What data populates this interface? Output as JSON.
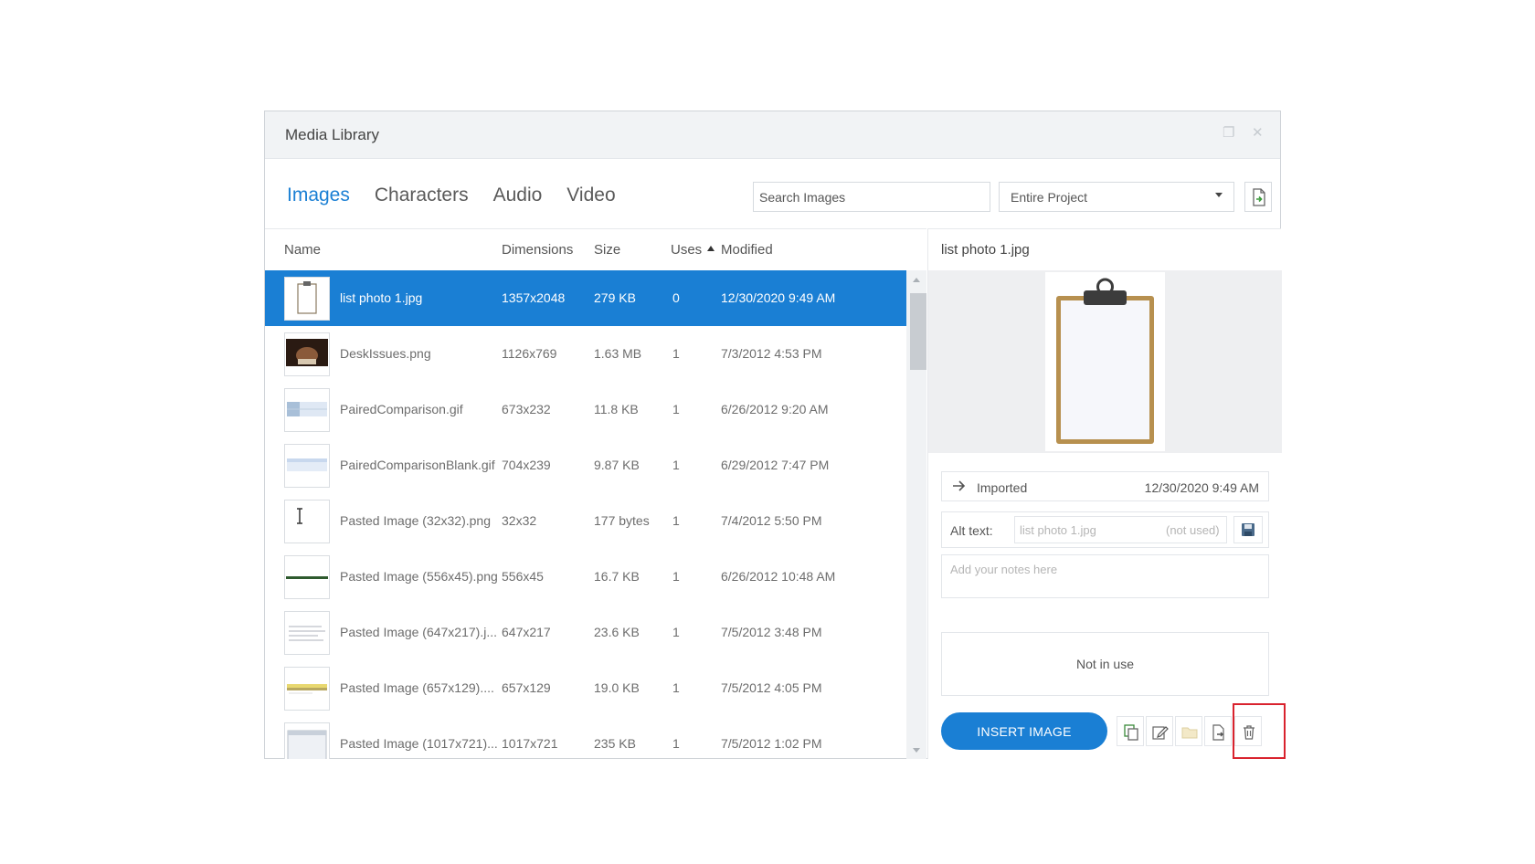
{
  "window": {
    "title": "Media Library"
  },
  "tabs": [
    {
      "label": "Images",
      "active": true
    },
    {
      "label": "Characters",
      "active": false
    },
    {
      "label": "Audio",
      "active": false
    },
    {
      "label": "Video",
      "active": false
    }
  ],
  "search": {
    "placeholder": "Search Images"
  },
  "scope": {
    "selected": "Entire Project"
  },
  "columns": {
    "name": "Name",
    "dimensions": "Dimensions",
    "size": "Size",
    "uses": "Uses",
    "modified": "Modified"
  },
  "files": [
    {
      "name": "list photo 1.jpg",
      "dimensions": "1357x2048",
      "size": "279 KB",
      "uses": "0",
      "modified": "12/30/2020 9:49 AM",
      "selected": true,
      "thumb": "clipboard"
    },
    {
      "name": "DeskIssues.png",
      "dimensions": "1126x769",
      "size": "1.63 MB",
      "uses": "1",
      "modified": "7/3/2012 4:53 PM",
      "selected": false,
      "thumb": "photo-dark"
    },
    {
      "name": "PairedComparison.gif",
      "dimensions": "673x232",
      "size": "11.8 KB",
      "uses": "1",
      "modified": "6/26/2012 9:20 AM",
      "selected": false,
      "thumb": "table-blue"
    },
    {
      "name": "PairedComparisonBlank.gif",
      "dimensions": "704x239",
      "size": "9.87 KB",
      "uses": "1",
      "modified": "6/29/2012 7:47 PM",
      "selected": false,
      "thumb": "table-light"
    },
    {
      "name": "Pasted Image (32x32).png",
      "dimensions": "32x32",
      "size": "177 bytes",
      "uses": "1",
      "modified": "7/4/2012 5:50 PM",
      "selected": false,
      "thumb": "text-cursor"
    },
    {
      "name": "Pasted Image (556x45).png",
      "dimensions": "556x45",
      "size": "16.7 KB",
      "uses": "1",
      "modified": "6/26/2012 10:48 AM",
      "selected": false,
      "thumb": "green-line"
    },
    {
      "name": "Pasted Image (647x217).j...",
      "dimensions": "647x217",
      "size": "23.6 KB",
      "uses": "1",
      "modified": "7/5/2012 3:48 PM",
      "selected": false,
      "thumb": "text-lines"
    },
    {
      "name": "Pasted Image (657x129)....",
      "dimensions": "657x129",
      "size": "19.0 KB",
      "uses": "1",
      "modified": "7/5/2012 4:05 PM",
      "selected": false,
      "thumb": "yellow-bar"
    },
    {
      "name": "Pasted Image (1017x721)...",
      "dimensions": "1017x721",
      "size": "235 KB",
      "uses": "1",
      "modified": "7/5/2012 1:02 PM",
      "selected": false,
      "thumb": "window"
    }
  ],
  "details": {
    "title": "list photo 1.jpg",
    "imported_label": "Imported",
    "imported_date": "12/30/2020 9:49 AM",
    "alt_label": "Alt text:",
    "alt_placeholder": "list photo 1.jpg",
    "alt_status": "(not used)",
    "notes_placeholder": "Add your notes here",
    "usage_text": "Not in use",
    "insert_label": "INSERT IMAGE"
  },
  "colors": {
    "accent": "#1a7fd4",
    "highlight": "#d9232e"
  }
}
